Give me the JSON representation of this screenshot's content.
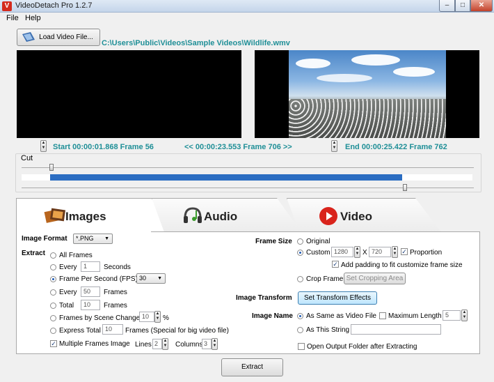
{
  "window": {
    "title": "VideoDetach Pro 1.2.7",
    "app_icon": "V",
    "min": "–",
    "max": "□",
    "close": "✕"
  },
  "menu": {
    "file": "File",
    "help": "Help"
  },
  "load": {
    "button": "Load Video File...",
    "path": "C:\\Users\\Public\\Videos\\Sample Videos\\Wildlife.wmv"
  },
  "timeline": {
    "start": "Start 00:00:01.868  Frame 56",
    "mid": "<< 00:00:23.553  Frame 706 >>",
    "end": "End 00:00:25.422  Frame 762",
    "cut_label": "Cut",
    "start_position": 0.066,
    "end_position": 0.848
  },
  "tabs": {
    "images": "Images",
    "audio": "Audio",
    "video": "Video"
  },
  "images": {
    "format_label": "Image Format",
    "format_value": "*.PNG",
    "extract_label": "Extract",
    "all_frames": "All Frames",
    "every": "Every",
    "every_seconds_value": "1",
    "seconds": "Seconds",
    "fps": "Frame Per Second (FPS)",
    "fps_value": "30",
    "every2": "Every",
    "every_frames_value": "50",
    "frames": "Frames",
    "total": "Total",
    "total_value": "10",
    "frames2": "Frames",
    "scene": "Frames by Scene Change",
    "scene_value": "10",
    "percent": "%",
    "express": "Express Total",
    "express_value": "10",
    "express_note": "Frames (Special for big video file)",
    "multi": "Multiple Frames Image",
    "lines": "Lines",
    "lines_value": "2",
    "columns": "Columns",
    "columns_value": "3",
    "frame_size_label": "Frame Size",
    "original": "Original",
    "custom": "Custom",
    "width_value": "1280",
    "x": "X",
    "height_value": "720",
    "proportion": "Proportion",
    "padding": "Add padding to fit customize frame size",
    "crop": "Crop Frame",
    "crop_btn": "Set Cropping Area",
    "transform_label": "Image Transform",
    "transform_btn": "Set Transform Effects",
    "name_label": "Image Name",
    "same_as_video": "As Same as Video File",
    "max_length": "Maximum Length",
    "max_length_value": "5",
    "as_string": "As This String",
    "string_value": "",
    "open_folder": "Open Output Folder after Extracting"
  },
  "extract_button": "Extract"
}
